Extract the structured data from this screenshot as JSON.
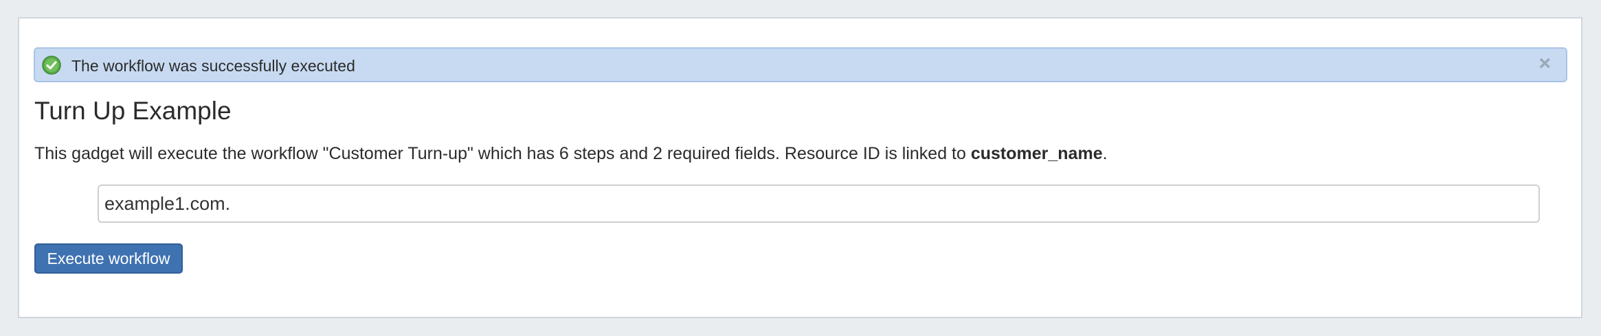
{
  "alert": {
    "icon": "check-circle-icon",
    "message": "The workflow was successfully executed",
    "close_glyph": "×",
    "color": "#c7daf2"
  },
  "gadget": {
    "title": "Turn Up Example",
    "description_prefix": "This gadget will execute the workflow \"Customer Turn-up\" which has 6 steps and 2 required fields. Resource ID is linked to ",
    "description_bold": "customer_name",
    "description_suffix": "."
  },
  "input": {
    "value": "example1.com."
  },
  "actions": {
    "execute_label": "Execute workflow",
    "button_color": "#3f72b1"
  }
}
